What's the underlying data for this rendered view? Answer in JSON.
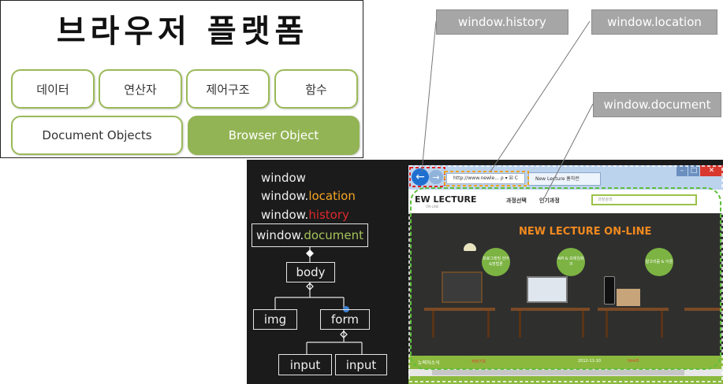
{
  "platform": {
    "title": "브라우저 플랫폼",
    "row1": [
      "데이터",
      "연산자",
      "제어구조",
      "함수"
    ],
    "row2": [
      "Document Objects",
      "Browser Object"
    ]
  },
  "callouts": {
    "history": "window.history",
    "location": "window.location",
    "document": "window.document"
  },
  "dom": {
    "window": "window",
    "location_prefix": "window.",
    "location_suffix": "location",
    "history_prefix": "window.",
    "history_suffix": "history",
    "document_prefix": "window.",
    "document_suffix": "document",
    "body": "body",
    "img": "img",
    "form": "form",
    "input1": "input",
    "input2": "input"
  },
  "browser": {
    "address": "http://www.newle... ρ ▾ ☒ C",
    "tab": "New Lecture 홈하런",
    "logo": "EW LECTURE",
    "logo_sub": "ON-LINE",
    "menu": [
      "과정선택",
      "인기과정"
    ],
    "search_placeholder": "과정검색",
    "hero_title": "NEW LECTURE ON-LINE",
    "bubbles": [
      "프로그래밍 언어&방법론",
      "API & 프레임워크",
      "알고리즘 & 이론"
    ],
    "footer_label": "뉴렉처소식",
    "footer_items": [
      "자바기초",
      "2012-11-10",
      "html5"
    ]
  },
  "colors": {
    "accent_green": "#92b455",
    "orange": "#f5a623",
    "red": "#e0282b",
    "document_green": "#a5c35a",
    "callout_gray": "#a6a6a6"
  }
}
